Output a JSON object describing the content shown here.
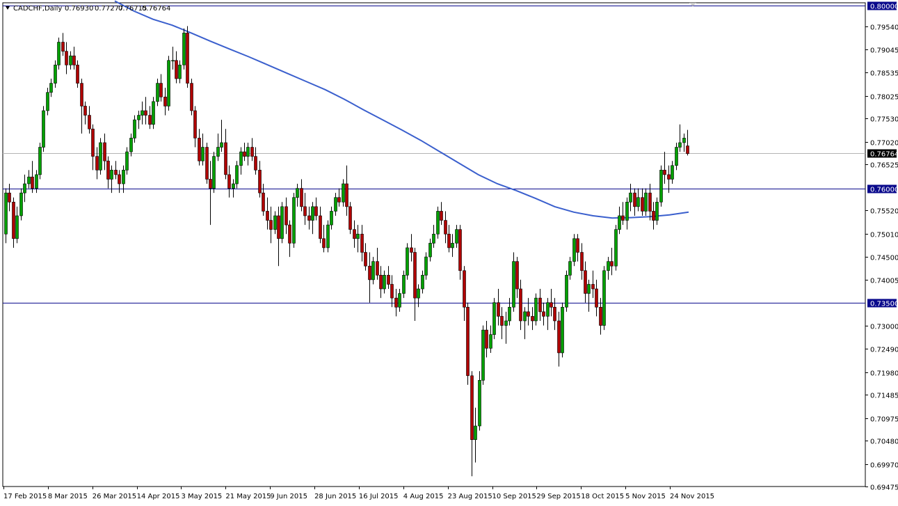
{
  "header": {
    "symbol": "CADCHF,Daily",
    "open": "0.76930",
    "high": "0.77277",
    "low": "0.76715",
    "close": "0.76764"
  },
  "chart_data": {
    "type": "candlestick",
    "title": "",
    "ylim": [
      0.69475,
      0.8
    ],
    "yticks": [
      "0.79540",
      "0.79045",
      "0.78535",
      "0.78025",
      "0.77530",
      "0.77020",
      "0.76525",
      "0.75520",
      "0.75010",
      "0.74500",
      "0.74005",
      "0.73000",
      "0.72490",
      "0.71980",
      "0.71485",
      "0.70975",
      "0.70480",
      "0.69970",
      "0.69475"
    ],
    "xtick_labels": [
      "17 Feb 2015",
      "8 Mar 2015",
      "26 Mar 2015",
      "14 Apr 2015",
      "3 May 2015",
      "21 May 2015",
      "9 Jun 2015",
      "28 Jun 2015",
      "16 Jul 2015",
      "4 Aug 2015",
      "23 Aug 2015",
      "10 Sep 2015",
      "29 Sep 2015",
      "18 Oct 2015",
      "5 Nov 2015",
      "24 Nov 2015"
    ],
    "horizontal_lines": [
      {
        "price": "0.80000",
        "value": 0.8
      },
      {
        "price": "0.76000",
        "value": 0.76
      },
      {
        "price": "0.73500",
        "value": 0.735
      }
    ],
    "current_price": {
      "label": "0.76764",
      "value": 0.76764
    },
    "bull_color": "#00a000",
    "bear_color": "#b00000",
    "ma_color": "#3a5fcd",
    "hline_color": "#0a0a8c",
    "badge_color": "#0a0a8c",
    "candles": [
      [
        0.75,
        0.76,
        0.748,
        0.759
      ],
      [
        0.759,
        0.761,
        0.755,
        0.757
      ],
      [
        0.757,
        0.758,
        0.747,
        0.749
      ],
      [
        0.749,
        0.756,
        0.748,
        0.754
      ],
      [
        0.754,
        0.76,
        0.753,
        0.759
      ],
      [
        0.759,
        0.763,
        0.757,
        0.761
      ],
      [
        0.761,
        0.764,
        0.76,
        0.7625
      ],
      [
        0.7625,
        0.766,
        0.759,
        0.76
      ],
      [
        0.76,
        0.764,
        0.759,
        0.763
      ],
      [
        0.763,
        0.77,
        0.762,
        0.769
      ],
      [
        0.769,
        0.778,
        0.768,
        0.777
      ],
      [
        0.777,
        0.782,
        0.776,
        0.781
      ],
      [
        0.781,
        0.784,
        0.78,
        0.783
      ],
      [
        0.783,
        0.788,
        0.782,
        0.787
      ],
      [
        0.787,
        0.793,
        0.786,
        0.792
      ],
      [
        0.792,
        0.794,
        0.789,
        0.79
      ],
      [
        0.79,
        0.792,
        0.785,
        0.787
      ],
      [
        0.787,
        0.79,
        0.786,
        0.789
      ],
      [
        0.789,
        0.791,
        0.786,
        0.787
      ],
      [
        0.787,
        0.788,
        0.782,
        0.783
      ],
      [
        0.783,
        0.784,
        0.772,
        0.778
      ],
      [
        0.778,
        0.779,
        0.774,
        0.776
      ],
      [
        0.776,
        0.778,
        0.772,
        0.773
      ],
      [
        0.773,
        0.774,
        0.764,
        0.767
      ],
      [
        0.767,
        0.769,
        0.762,
        0.764
      ],
      [
        0.764,
        0.771,
        0.763,
        0.77
      ],
      [
        0.77,
        0.772,
        0.764,
        0.766
      ],
      [
        0.766,
        0.767,
        0.76,
        0.762
      ],
      [
        0.762,
        0.765,
        0.759,
        0.764
      ],
      [
        0.764,
        0.766,
        0.762,
        0.763
      ],
      [
        0.763,
        0.764,
        0.759,
        0.761
      ],
      [
        0.761,
        0.765,
        0.759,
        0.764
      ],
      [
        0.764,
        0.769,
        0.763,
        0.768
      ],
      [
        0.768,
        0.772,
        0.767,
        0.771
      ],
      [
        0.771,
        0.776,
        0.77,
        0.775
      ],
      [
        0.775,
        0.777,
        0.773,
        0.776
      ],
      [
        0.776,
        0.779,
        0.774,
        0.777
      ],
      [
        0.777,
        0.78,
        0.774,
        0.776
      ],
      [
        0.776,
        0.778,
        0.773,
        0.774
      ],
      [
        0.774,
        0.78,
        0.773,
        0.779
      ],
      [
        0.779,
        0.784,
        0.778,
        0.783
      ],
      [
        0.783,
        0.785,
        0.779,
        0.78
      ],
      [
        0.78,
        0.782,
        0.776,
        0.778
      ],
      [
        0.778,
        0.789,
        0.777,
        0.788
      ],
      [
        0.788,
        0.791,
        0.786,
        0.788
      ],
      [
        0.788,
        0.79,
        0.783,
        0.784
      ],
      [
        0.784,
        0.788,
        0.783,
        0.787
      ],
      [
        0.787,
        0.795,
        0.786,
        0.794
      ],
      [
        0.794,
        0.7955,
        0.782,
        0.783
      ],
      [
        0.783,
        0.784,
        0.776,
        0.777
      ],
      [
        0.777,
        0.778,
        0.769,
        0.771
      ],
      [
        0.771,
        0.773,
        0.765,
        0.766
      ],
      [
        0.766,
        0.772,
        0.765,
        0.769
      ],
      [
        0.769,
        0.77,
        0.761,
        0.762
      ],
      [
        0.762,
        0.766,
        0.752,
        0.76
      ],
      [
        0.76,
        0.768,
        0.759,
        0.767
      ],
      [
        0.767,
        0.772,
        0.766,
        0.769
      ],
      [
        0.769,
        0.775,
        0.768,
        0.77
      ],
      [
        0.77,
        0.773,
        0.762,
        0.763
      ],
      [
        0.763,
        0.765,
        0.758,
        0.76
      ],
      [
        0.76,
        0.762,
        0.758,
        0.761
      ],
      [
        0.761,
        0.766,
        0.76,
        0.765
      ],
      [
        0.765,
        0.769,
        0.763,
        0.768
      ],
      [
        0.768,
        0.77,
        0.766,
        0.767
      ],
      [
        0.767,
        0.77,
        0.765,
        0.769
      ],
      [
        0.769,
        0.771,
        0.766,
        0.767
      ],
      [
        0.767,
        0.769,
        0.763,
        0.764
      ],
      [
        0.764,
        0.766,
        0.758,
        0.759
      ],
      [
        0.759,
        0.761,
        0.754,
        0.755
      ],
      [
        0.755,
        0.758,
        0.751,
        0.753
      ],
      [
        0.753,
        0.756,
        0.748,
        0.751
      ],
      [
        0.751,
        0.755,
        0.75,
        0.754
      ],
      [
        0.754,
        0.756,
        0.743,
        0.749
      ],
      [
        0.749,
        0.757,
        0.748,
        0.756
      ],
      [
        0.756,
        0.758,
        0.75,
        0.752
      ],
      [
        0.752,
        0.753,
        0.745,
        0.748
      ],
      [
        0.748,
        0.759,
        0.747,
        0.758
      ],
      [
        0.758,
        0.761,
        0.756,
        0.76
      ],
      [
        0.76,
        0.762,
        0.755,
        0.756
      ],
      [
        0.756,
        0.759,
        0.752,
        0.754
      ],
      [
        0.754,
        0.756,
        0.751,
        0.753
      ],
      [
        0.753,
        0.757,
        0.75,
        0.756
      ],
      [
        0.756,
        0.758,
        0.753,
        0.754
      ],
      [
        0.754,
        0.756,
        0.748,
        0.749
      ],
      [
        0.749,
        0.752,
        0.746,
        0.747
      ],
      [
        0.747,
        0.753,
        0.746,
        0.752
      ],
      [
        0.752,
        0.756,
        0.751,
        0.755
      ],
      [
        0.755,
        0.759,
        0.754,
        0.758
      ],
      [
        0.758,
        0.76,
        0.756,
        0.757
      ],
      [
        0.757,
        0.762,
        0.756,
        0.761
      ],
      [
        0.761,
        0.765,
        0.754,
        0.756
      ],
      [
        0.756,
        0.757,
        0.75,
        0.751
      ],
      [
        0.751,
        0.753,
        0.747,
        0.749
      ],
      [
        0.749,
        0.752,
        0.746,
        0.75
      ],
      [
        0.75,
        0.752,
        0.744,
        0.746
      ],
      [
        0.746,
        0.748,
        0.742,
        0.743
      ],
      [
        0.743,
        0.746,
        0.735,
        0.74
      ],
      [
        0.74,
        0.745,
        0.739,
        0.744
      ],
      [
        0.744,
        0.747,
        0.74,
        0.741
      ],
      [
        0.741,
        0.743,
        0.736,
        0.738
      ],
      [
        0.738,
        0.742,
        0.737,
        0.741
      ],
      [
        0.741,
        0.743,
        0.738,
        0.739
      ],
      [
        0.739,
        0.741,
        0.734,
        0.736
      ],
      [
        0.736,
        0.738,
        0.732,
        0.734
      ],
      [
        0.734,
        0.738,
        0.733,
        0.737
      ],
      [
        0.737,
        0.742,
        0.736,
        0.741
      ],
      [
        0.741,
        0.748,
        0.74,
        0.747
      ],
      [
        0.747,
        0.75,
        0.744,
        0.746
      ],
      [
        0.746,
        0.747,
        0.731,
        0.736
      ],
      [
        0.736,
        0.739,
        0.734,
        0.738
      ],
      [
        0.738,
        0.742,
        0.737,
        0.741
      ],
      [
        0.741,
        0.746,
        0.74,
        0.745
      ],
      [
        0.745,
        0.749,
        0.744,
        0.748
      ],
      [
        0.748,
        0.752,
        0.747,
        0.75
      ],
      [
        0.75,
        0.756,
        0.749,
        0.755
      ],
      [
        0.755,
        0.757,
        0.752,
        0.753
      ],
      [
        0.753,
        0.755,
        0.748,
        0.75
      ],
      [
        0.75,
        0.752,
        0.746,
        0.747
      ],
      [
        0.747,
        0.75,
        0.745,
        0.748
      ],
      [
        0.748,
        0.752,
        0.747,
        0.751
      ],
      [
        0.751,
        0.752,
        0.74,
        0.742
      ],
      [
        0.742,
        0.743,
        0.731,
        0.734
      ],
      [
        0.734,
        0.735,
        0.717,
        0.719
      ],
      [
        0.719,
        0.72,
        0.697,
        0.705
      ],
      [
        0.705,
        0.712,
        0.7,
        0.708
      ],
      [
        0.708,
        0.72,
        0.707,
        0.718
      ],
      [
        0.718,
        0.73,
        0.717,
        0.729
      ],
      [
        0.729,
        0.731,
        0.723,
        0.725
      ],
      [
        0.725,
        0.73,
        0.724,
        0.728
      ],
      [
        0.728,
        0.736,
        0.727,
        0.735
      ],
      [
        0.735,
        0.738,
        0.73,
        0.732
      ],
      [
        0.732,
        0.734,
        0.727,
        0.73
      ],
      [
        0.73,
        0.733,
        0.726,
        0.731
      ],
      [
        0.731,
        0.736,
        0.73,
        0.734
      ],
      [
        0.734,
        0.746,
        0.733,
        0.744
      ],
      [
        0.744,
        0.745,
        0.736,
        0.738
      ],
      [
        0.738,
        0.74,
        0.729,
        0.731
      ],
      [
        0.731,
        0.734,
        0.727,
        0.733
      ],
      [
        0.733,
        0.736,
        0.73,
        0.732
      ],
      [
        0.732,
        0.734,
        0.729,
        0.731
      ],
      [
        0.731,
        0.737,
        0.73,
        0.736
      ],
      [
        0.736,
        0.738,
        0.731,
        0.733
      ],
      [
        0.733,
        0.735,
        0.73,
        0.732
      ],
      [
        0.732,
        0.736,
        0.729,
        0.735
      ],
      [
        0.735,
        0.738,
        0.732,
        0.734
      ],
      [
        0.734,
        0.736,
        0.729,
        0.731
      ],
      [
        0.731,
        0.733,
        0.721,
        0.724
      ],
      [
        0.724,
        0.735,
        0.723,
        0.734
      ],
      [
        0.734,
        0.742,
        0.733,
        0.741
      ],
      [
        0.741,
        0.745,
        0.74,
        0.744
      ],
      [
        0.744,
        0.75,
        0.743,
        0.749
      ],
      [
        0.749,
        0.75,
        0.744,
        0.746
      ],
      [
        0.746,
        0.748,
        0.74,
        0.742
      ],
      [
        0.742,
        0.744,
        0.735,
        0.737
      ],
      [
        0.737,
        0.74,
        0.733,
        0.739
      ],
      [
        0.739,
        0.742,
        0.736,
        0.738
      ],
      [
        0.738,
        0.74,
        0.732,
        0.734
      ],
      [
        0.734,
        0.736,
        0.728,
        0.73
      ],
      [
        0.73,
        0.743,
        0.729,
        0.742
      ],
      [
        0.742,
        0.745,
        0.74,
        0.744
      ],
      [
        0.744,
        0.747,
        0.741,
        0.743
      ],
      [
        0.743,
        0.752,
        0.742,
        0.751
      ],
      [
        0.751,
        0.756,
        0.75,
        0.754
      ],
      [
        0.754,
        0.757,
        0.752,
        0.753
      ],
      [
        0.753,
        0.758,
        0.751,
        0.757
      ],
      [
        0.757,
        0.761,
        0.755,
        0.759
      ],
      [
        0.759,
        0.76,
        0.754,
        0.756
      ],
      [
        0.756,
        0.76,
        0.755,
        0.758
      ],
      [
        0.758,
        0.76,
        0.754,
        0.755
      ],
      [
        0.755,
        0.76,
        0.754,
        0.759
      ],
      [
        0.759,
        0.761,
        0.753,
        0.755
      ],
      [
        0.755,
        0.757,
        0.751,
        0.753
      ],
      [
        0.753,
        0.758,
        0.752,
        0.757
      ],
      [
        0.757,
        0.765,
        0.756,
        0.764
      ],
      [
        0.764,
        0.768,
        0.761,
        0.763
      ],
      [
        0.763,
        0.765,
        0.759,
        0.762
      ],
      [
        0.762,
        0.766,
        0.761,
        0.765
      ],
      [
        0.765,
        0.77,
        0.764,
        0.769
      ],
      [
        0.769,
        0.774,
        0.768,
        0.77
      ],
      [
        0.77,
        0.772,
        0.768,
        0.771
      ],
      [
        0.7693,
        0.7728,
        0.7672,
        0.7676
      ]
    ],
    "ma": [
      0.801,
      0.7988,
      0.797,
      0.7957,
      0.794,
      0.7922,
      0.7905,
      0.7888,
      0.787,
      0.7852,
      0.7834,
      0.7816,
      0.7795,
      0.7772,
      0.775,
      0.7728,
      0.7705,
      0.768,
      0.7655,
      0.763,
      0.761,
      0.7595,
      0.7578,
      0.756,
      0.7548,
      0.754,
      0.7535,
      0.7536,
      0.7538,
      0.7542,
      0.7548
    ]
  }
}
